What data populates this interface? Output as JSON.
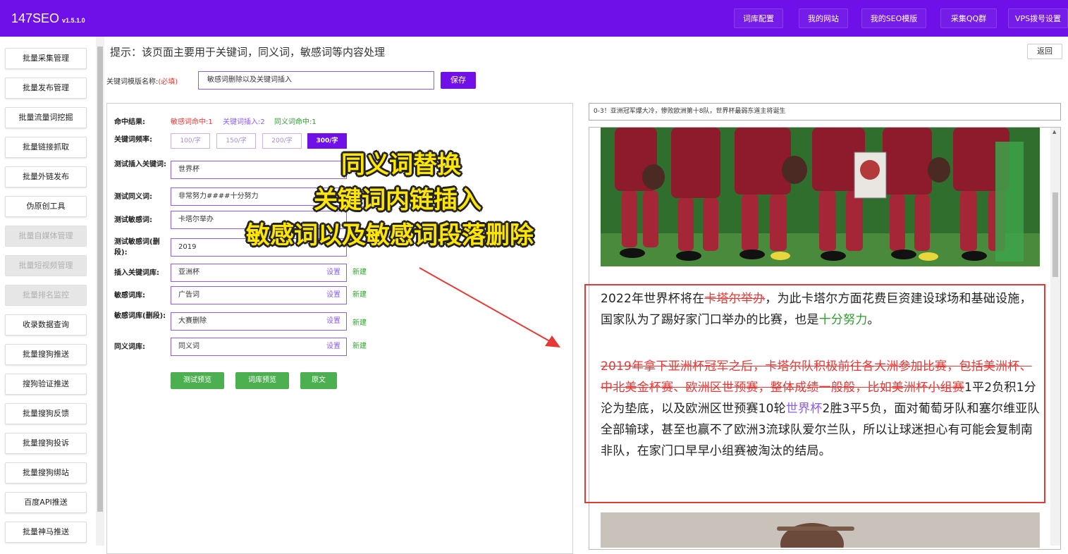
{
  "app": {
    "logo": "147SEO",
    "version": "v1.5.1.0"
  },
  "nav": [
    {
      "label": "词库配置"
    },
    {
      "label": "我的网站"
    },
    {
      "label": "我的SEO模版"
    },
    {
      "label": "采集QQ群"
    },
    {
      "label": "VPS拨号设置"
    }
  ],
  "sidebar": {
    "items": [
      {
        "label": "批量采集管理",
        "disabled": false
      },
      {
        "label": "批量发布管理",
        "disabled": false
      },
      {
        "label": "批量流量词挖掘",
        "disabled": false
      },
      {
        "label": "批量链接抓取",
        "disabled": false
      },
      {
        "label": "批量外链发布",
        "disabled": false
      },
      {
        "label": "伪原创工具",
        "disabled": false
      },
      {
        "label": "批量自媒体管理",
        "disabled": true
      },
      {
        "label": "批量短视频管理",
        "disabled": true
      },
      {
        "label": "批量排名监控",
        "disabled": true
      },
      {
        "label": "收录数据查询",
        "disabled": false
      },
      {
        "label": "批量搜狗推送",
        "disabled": false
      },
      {
        "label": "搜狗验证推送",
        "disabled": false
      },
      {
        "label": "批量搜狗反馈",
        "disabled": false
      },
      {
        "label": "批量搜狗投诉",
        "disabled": false
      },
      {
        "label": "批量搜狗绑站",
        "disabled": false
      },
      {
        "label": "百度API推送",
        "disabled": false
      },
      {
        "label": "批量神马推送",
        "disabled": false
      }
    ]
  },
  "header": {
    "hint": "提示：该页面主要用于关键词，同义词，敏感词等内容处理",
    "back": "返回",
    "template_label": "关键词模版名称:",
    "required": "(必填)",
    "template_value": "敏感词删除以及关键词插入",
    "save": "保存"
  },
  "form": {
    "result_label": "命中结果:",
    "result_sensitive": "敏感词命中:1",
    "result_keyword": "关键词插入:2",
    "result_synonym": "同义词命中:1",
    "freq_label": "关键词频率:",
    "freq_options": [
      "100/字",
      "150/字",
      "200/字",
      "300/字"
    ],
    "freq_selected": "300/字",
    "insert_kw_label": "测试插入关键词:",
    "insert_kw_value": "世界杯",
    "synonym_label": "测试同义词:",
    "synonym_value": "非常努力####十分努力",
    "sensitive_label": "测试敏感词:",
    "sensitive_value": "卡塔尔举办",
    "sensitive_del_label": "测试敏感词(删段):",
    "sensitive_del_value": "2019",
    "insert_lib_label": "插入关键词库:",
    "insert_lib_value": "亚洲杯",
    "sens_lib_label": "敏感词库:",
    "sens_lib_value": "广告词",
    "sens_del_lib_label": "敏感词库(删段):",
    "sens_del_lib_value": "大赛删除",
    "syn_lib_label": "同义词库:",
    "syn_lib_value": "同义词",
    "set": "设置",
    "new": "新建",
    "btn_test": "测试预览",
    "btn_lib": "词库预览",
    "btn_orig": "原文"
  },
  "preview": {
    "title": "0-3！亚洲冠军爆大冷，惨败欧洲第十8队，世界杯最弱东道主将诞生",
    "p1_a": "2022年世界杯将在",
    "p1_strike": "卡塔尔举办",
    "p1_b": "，为此卡塔尔方面花费巨资建设球场和基础设施，国家队为了踢好家门口举办的比赛，也是",
    "p1_syn": "十分努力",
    "p1_c": "。",
    "p2_strike": "2019年拿下亚洲杯冠军之后，卡塔尔队积极前往各大洲参加比赛，包括美洲杯、中北美金杯赛、欧洲区世预赛，整体成绩一般般，比如美洲杯小组赛",
    "p2_a": "1平2负积1分沦为垫底，以及欧洲区世预赛10轮",
    "p2_kw": "世界杯",
    "p2_b": "2胜3平5负，面对葡萄牙队和塞尔维亚队全部输球，甚至也赢不了欧洲3流球队爱尔兰队，所以让球迷担心有可能会复制南非队，在家门口早早小组赛被淘汰的结局。"
  },
  "overlay": {
    "line1": "同义词替换",
    "line2": "关键词内链插入",
    "line3": "敏感词以及敏感词段落删除"
  },
  "colors": {
    "brand": "#6f10e8",
    "green": "#4caf50",
    "red": "#e53935",
    "purple": "#8b5cf6"
  }
}
